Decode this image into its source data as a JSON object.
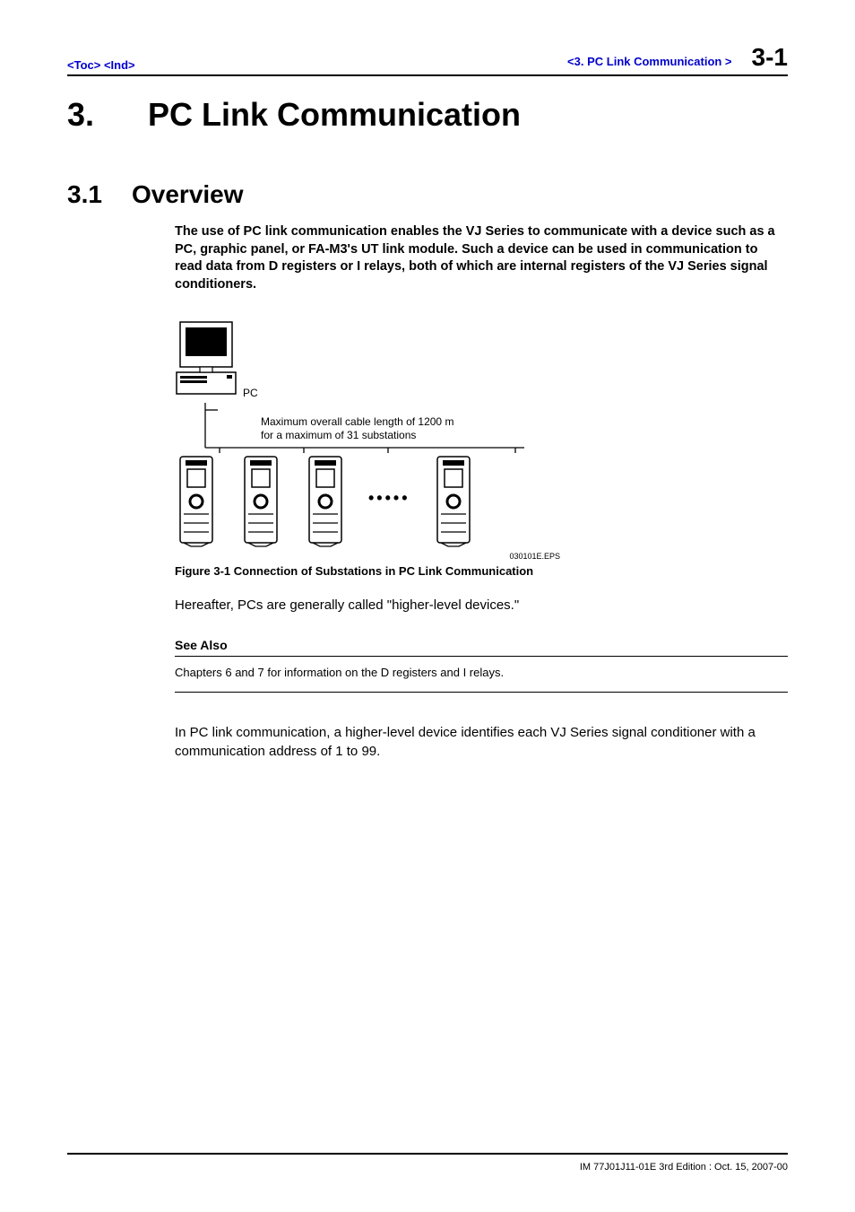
{
  "header": {
    "toc": "<Toc>",
    "ind": "<Ind>",
    "breadcrumb": "<3.  PC Link Communication >",
    "page_no": "3-1"
  },
  "chapter": {
    "number": "3.",
    "title": "PC Link Communication"
  },
  "section": {
    "number": "3.1",
    "title": "Overview"
  },
  "intro": "The use of PC link communication enables the VJ Series to communicate with a device such as a PC, graphic panel, or FA-M3's UT link module. Such a device can be used in communication to read data from D registers or I relays, both of which are internal registers of the VJ Series signal conditioners.",
  "figure": {
    "pc_label": "PC",
    "bus_caption_line1": "Maximum overall cable length of 1200 m",
    "bus_caption_line2": "for a maximum of 31 substations",
    "eps": "030101E.EPS",
    "caption": "Figure 3-1   Connection of Substations in PC Link Communication"
  },
  "para_after_figure": "Hereafter, PCs are generally called \"higher-level devices.\"",
  "see_also": {
    "title": "See Also",
    "body": "Chapters 6 and 7 for information on the D registers and I relays."
  },
  "para_last": "In PC link communication, a higher-level device identifies each VJ Series signal conditioner with a communication address of 1 to 99.",
  "footer": "IM 77J01J11-01E    3rd Edition : Oct. 15, 2007-00"
}
